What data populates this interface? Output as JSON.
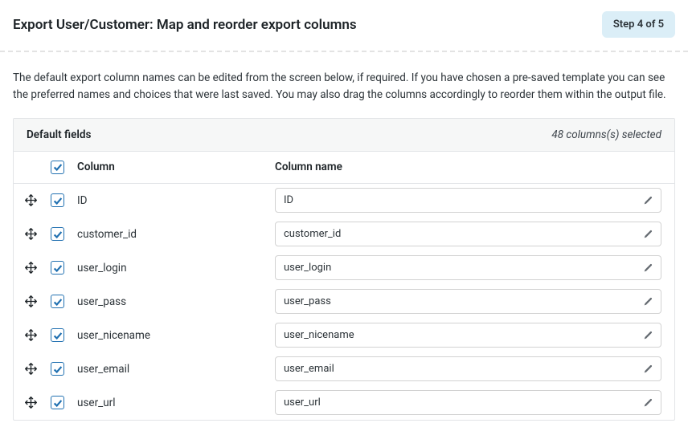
{
  "header": {
    "title": "Export User/Customer: Map and reorder export columns",
    "step": "Step 4 of 5"
  },
  "description": "The default export column names can be edited from the screen below, if required. If you have chosen a pre-saved template you can see the preferred names and choices that were last saved. You may also drag the columns accordingly to reorder them within the output file.",
  "panel": {
    "title": "Default fields",
    "selected": "48 columns(s) selected",
    "column_label": "Column",
    "column_name_label": "Column name"
  },
  "rows": [
    {
      "source": "ID",
      "name": "ID"
    },
    {
      "source": "customer_id",
      "name": "customer_id"
    },
    {
      "source": "user_login",
      "name": "user_login"
    },
    {
      "source": "user_pass",
      "name": "user_pass"
    },
    {
      "source": "user_nicename",
      "name": "user_nicename"
    },
    {
      "source": "user_email",
      "name": "user_email"
    },
    {
      "source": "user_url",
      "name": "user_url"
    }
  ]
}
